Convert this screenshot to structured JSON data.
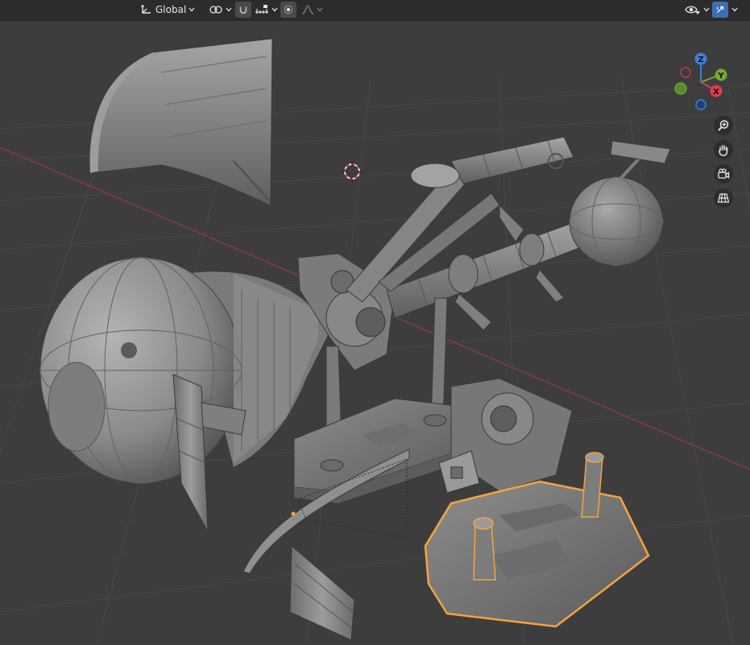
{
  "header": {
    "transform_orientation": "Global"
  },
  "gizmo": {
    "axes": {
      "z": "Z",
      "y": "Y",
      "x": "X"
    },
    "colors": {
      "x": "#e13a50",
      "y": "#76a832",
      "z": "#3d7ed6"
    }
  },
  "nav": {
    "icons": [
      "zoom-icon",
      "hand-pan-icon",
      "camera-icon",
      "grid-perspective-icon"
    ]
  },
  "colors": {
    "viewport_bg": "#3d3d3d",
    "header_bg": "#2c2c2c",
    "selection_outline": "#f5a340",
    "x_axis_line": "#8b3a3a"
  }
}
